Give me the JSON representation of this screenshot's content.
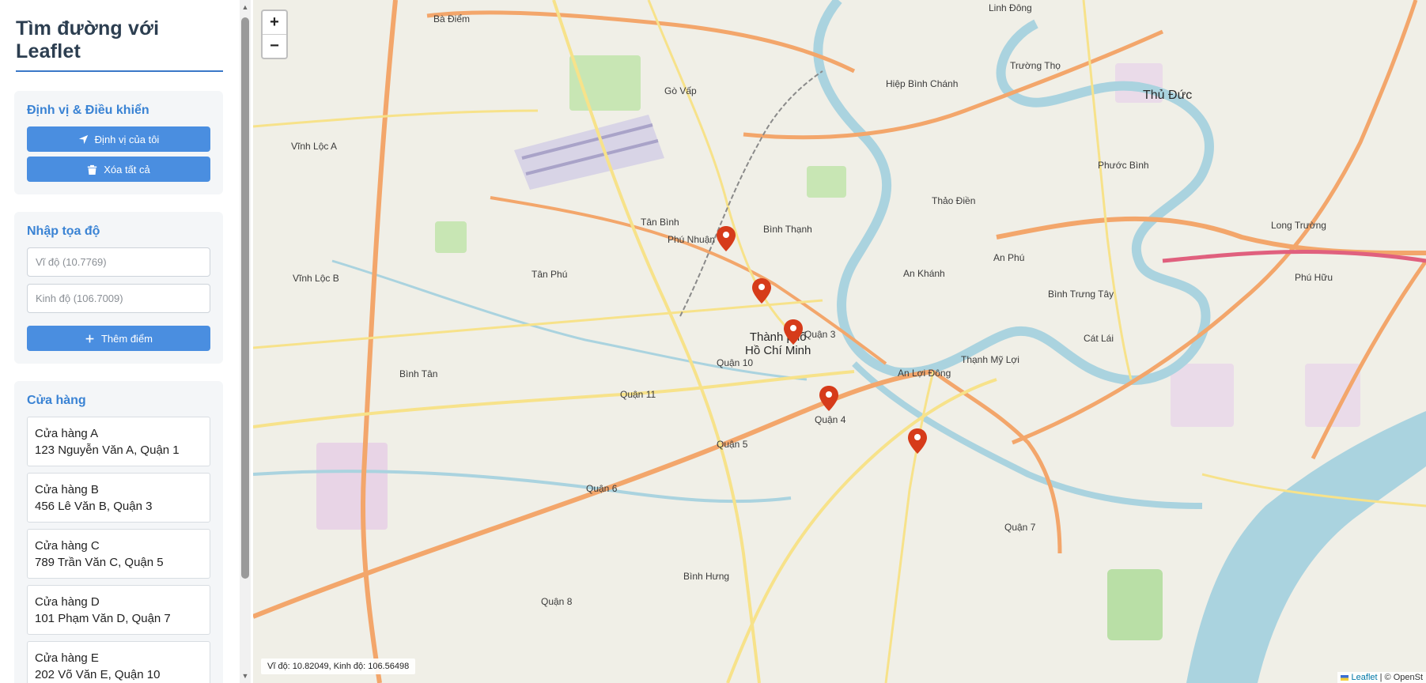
{
  "app": {
    "title": "Tìm đường với Leaflet"
  },
  "controls_panel": {
    "title": "Định vị & Điều khiển",
    "locate_label": "Định vị của tôi",
    "clear_label": "Xóa tất cả"
  },
  "coords_panel": {
    "title": "Nhập tọa độ",
    "lat_placeholder": "Vĩ độ (10.7769)",
    "lng_placeholder": "Kinh độ (106.7009)",
    "add_label": "Thêm điểm"
  },
  "stores_panel": {
    "title": "Cửa hàng",
    "items": [
      {
        "name": "Cửa hàng A",
        "address": "123 Nguyễn Văn A, Quận 1"
      },
      {
        "name": "Cửa hàng B",
        "address": "456 Lê Văn B, Quận 3"
      },
      {
        "name": "Cửa hàng C",
        "address": "789 Trần Văn C, Quận 5"
      },
      {
        "name": "Cửa hàng D",
        "address": "101 Phạm Văn D, Quận 7"
      },
      {
        "name": "Cửa hàng E",
        "address": "202 Võ Văn E, Quận 10"
      }
    ]
  },
  "map": {
    "zoom_in": "+",
    "zoom_out": "−",
    "coords_readout": "Vĩ độ: 10.82049, Kinh độ: 106.56498",
    "attribution_leaflet": "Leaflet",
    "attribution_rest": " | © OpenSt",
    "labels": {
      "hcmc_line1": "Thành phố",
      "hcmc_line2": "Hồ Chí Minh",
      "thu_duc": "Thủ Đức",
      "go_vap": "Gò Vấp",
      "tan_binh": "Tân Bình",
      "tan_phu": "Tân Phú",
      "binh_tan": "Bình Tân",
      "binh_thanh": "Bình Thạnh",
      "phu_nhuan": "Phú Nhuận",
      "quan_3": "Quận 3",
      "quan_4": "Quận 4",
      "quan_5": "Quận 5",
      "quan_6": "Quận 6",
      "quan_7": "Quận 7",
      "quan_8": "Quận 8",
      "quan_10": "Quận 10",
      "quan_11": "Quận 11",
      "binh_hung": "Bình Hưng",
      "an_khanh": "An Khánh",
      "an_phu": "An Phú",
      "an_loi_dong": "An Lợi Đông",
      "thao_dien": "Thảo Điền",
      "cat_lai": "Cát Lái",
      "vinh_loc_a": "Vĩnh Lộc A",
      "vinh_loc_b": "Vĩnh Lộc B",
      "linh_dong": "Linh Đông",
      "hiep_binh_chanh": "Hiệp Bình Chánh",
      "truong_tho": "Trường Thọ",
      "phuoc_binh": "Phước Bình",
      "long_truong": "Long Trường",
      "phu_huu": "Phú Hữu",
      "binh_diem": "Bà Điểm",
      "binh_trung_tay": "Bình Trưng Tây",
      "thanh_my_loi": "Thạnh Mỹ Lợi"
    }
  },
  "colors": {
    "accent": "#4a8ee0",
    "title_blue": "#3a83d4",
    "marker_red": "#d63b1a",
    "river": "#aad3df"
  },
  "icons": {
    "locate": "location-arrow-icon",
    "clear": "trash-icon",
    "add": "plus-icon",
    "marker": "map-marker-icon"
  }
}
